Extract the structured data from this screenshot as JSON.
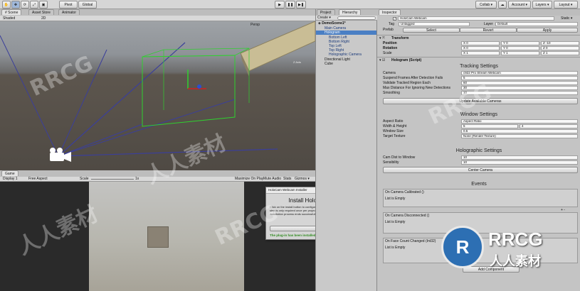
{
  "toolbar": {
    "pivot": "Pivot",
    "global": "Global",
    "collab": "Collab ▾",
    "account": "Account ▾",
    "layers": "Layers ▾",
    "layout": "Layout ▾"
  },
  "scene": {
    "tabs": [
      "# Scene",
      "Asset Store",
      "Animator"
    ],
    "shading": "Shaded",
    "mode": "2D",
    "persp": "Persp",
    "axis_label": "Z Axis"
  },
  "game": {
    "tab": "Game",
    "display": "Display 1",
    "aspect": "Free Aspect",
    "scale_label": "Scale",
    "scale_value": "1x",
    "options": [
      "Maximize On Play",
      "Mute Audio",
      "Stats",
      "Gizmos ▾"
    ]
  },
  "dialog": {
    "window_title": "HoloCam Webcam Installer",
    "heading": "Install HoloCam Webcam",
    "body": "Click on the install button to configure the HoloCam Webcam native libraries. This step is only required once per project. This popup won't show again after the installation process ends successfully.",
    "install_button": "Install",
    "status": "The plug-in has been installed!"
  },
  "project": {
    "tabs": [
      "Project",
      "Hierarchy"
    ],
    "create": "Create ▾",
    "scene_name": "DemoScene1*",
    "items": [
      "Main Camera",
      "Hologram",
      "Bottom Left",
      "Bottom Right",
      "Top Left",
      "Top Right",
      "Holographic Camera",
      "Directional Light",
      "Cube"
    ]
  },
  "inspector": {
    "tab": "Inspector",
    "object_name": "HoloCam Webcam",
    "static": "Static ▾",
    "tag_label": "Tag",
    "tag": "Untagged",
    "layer_label": "Layer",
    "layer": "Default",
    "prefab_label": "Prefab",
    "prefab_buttons": [
      "Select",
      "Revert",
      "Apply"
    ],
    "transform": {
      "title": "Transform",
      "rows": [
        {
          "label": "Position",
          "x": "X 0",
          "y": "Y 0",
          "z": "Z -10"
        },
        {
          "label": "Rotation",
          "x": "X 0",
          "y": "Y 0",
          "z": "Z 0"
        },
        {
          "label": "Scale",
          "x": "X 1",
          "y": "Y 1",
          "z": "Z 1"
        }
      ]
    },
    "script_title": "Hologram (Script)",
    "tracking": {
      "header": "Tracking Settings",
      "rows": [
        {
          "label": "Camera",
          "value": "c922 Pro Stream Webcam"
        },
        {
          "label": "Suspend Frames After Detection Fails",
          "value": "5"
        },
        {
          "label": "Validate Tracked Region Each",
          "value": "60"
        },
        {
          "label": "Max Distance For Ignoring New Detections",
          "value": "30"
        },
        {
          "label": "Smoothing",
          "value": "10"
        }
      ],
      "button": "Update Available Cameras"
    },
    "window": {
      "header": "Window Settings",
      "rows": [
        {
          "label": "Aspect Ratio",
          "value": "Aspect Ratio"
        },
        {
          "label": "Width & Height",
          "value": "5"
        },
        {
          "label": "Window Size",
          "value": "0.5"
        },
        {
          "label": "Target Texture",
          "value": "None (Render Texture)"
        }
      ],
      "wh_extra": "4"
    },
    "holographic": {
      "header": "Holographic Settings",
      "rows": [
        {
          "label": "Cam Dist to Window",
          "value": "10"
        },
        {
          "label": "Sensibility",
          "value": "10"
        }
      ],
      "button": "Center Camera"
    },
    "events": {
      "header": "Events",
      "items": [
        {
          "title": "On Camera Calibrated ()",
          "body": "List is Empty"
        },
        {
          "title": "On Camera Disconnected ()",
          "body": "List is Empty"
        },
        {
          "title": "On Face Count Changed (Int32)",
          "body": "List is Empty"
        }
      ],
      "add_remove": "+ -",
      "footer_button": "Add Component"
    }
  },
  "watermark": {
    "brand": "RRCG",
    "cn": "人人素材"
  }
}
